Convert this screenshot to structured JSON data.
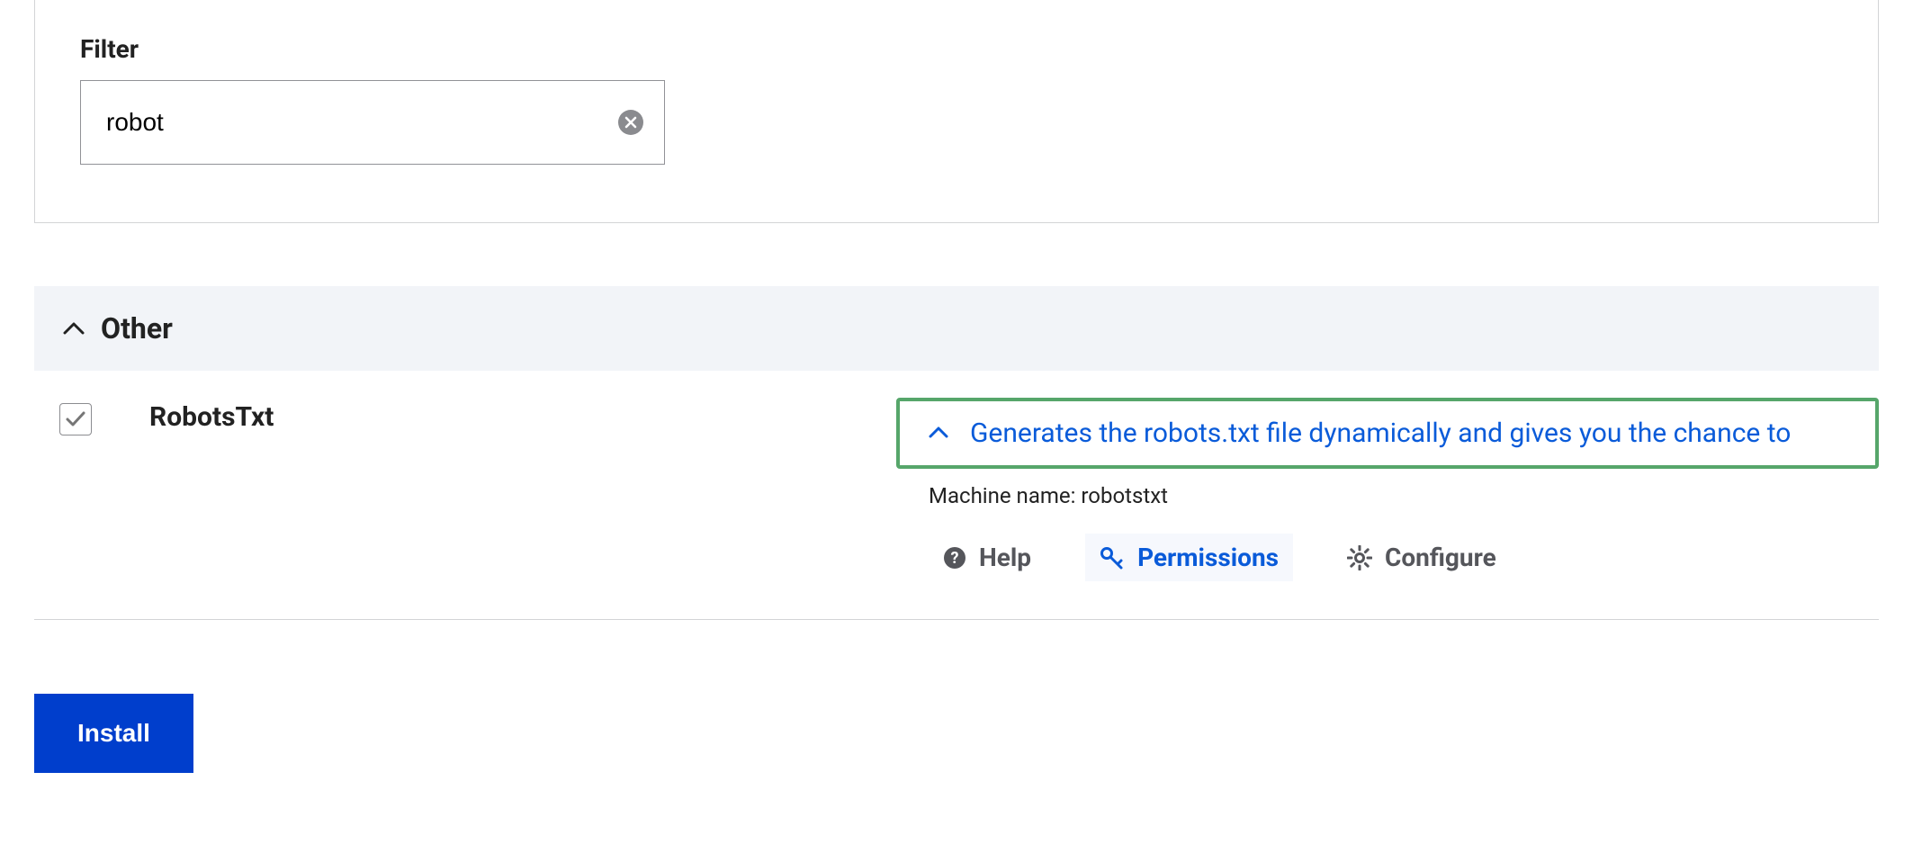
{
  "filter": {
    "label": "Filter",
    "value": "robot"
  },
  "section": {
    "title": "Other"
  },
  "module": {
    "checked": true,
    "name": "RobotsTxt",
    "description": "Generates the robots.txt file dynamically and gives you the chance to",
    "machine_name_label": "Machine name: ",
    "machine_name": "robotstxt"
  },
  "actions": {
    "help": "Help",
    "permissions": "Permissions",
    "configure": "Configure"
  },
  "install_label": "Install",
  "colors": {
    "accent_blue": "#0a5bd9",
    "highlight_green": "#56a66a",
    "panel_bg": "#f2f4f8"
  }
}
